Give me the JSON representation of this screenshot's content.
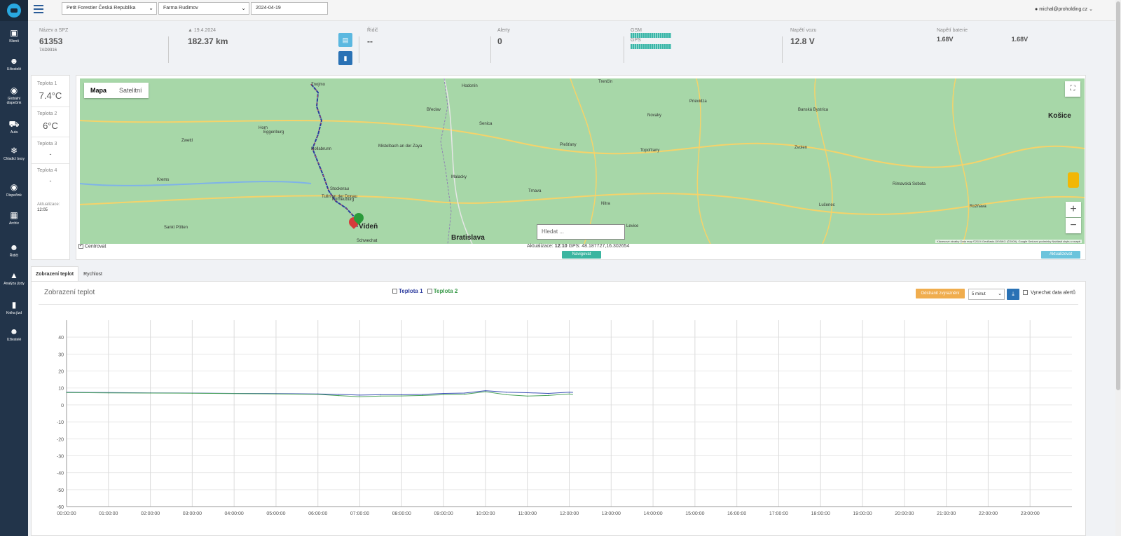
{
  "topbar": {
    "company": "Petit Forestier Česká Republika",
    "farm": "Farma Rudimov",
    "date": "2024-04-19",
    "user": "michal@proholding.cz"
  },
  "sidebar": {
    "items": [
      {
        "label": "Klienti",
        "icon": "briefcase-icon"
      },
      {
        "label": "Uživatelé",
        "icon": "users-icon"
      },
      {
        "label": "Globální dispečink",
        "icon": "compass-icon"
      },
      {
        "label": "Auta",
        "icon": "truck-icon"
      },
      {
        "label": "Chladicí boxy",
        "icon": "snowflake-icon"
      },
      {
        "label": "Dispečink",
        "icon": "car-icon"
      },
      {
        "label": "Archiv",
        "icon": "archive-icon"
      },
      {
        "label": "Řidiči",
        "icon": "driver-icon"
      },
      {
        "label": "Analýza jízdy",
        "icon": "area-chart-icon"
      },
      {
        "label": "Kniha jízd",
        "icon": "book-icon"
      },
      {
        "label": "Uživatelé",
        "icon": "users-icon"
      }
    ]
  },
  "stats": {
    "name_label": "Název a SPZ",
    "name_value": "61353",
    "spz": "7AD9316",
    "date_label": "19.4.2024",
    "distance": "182.37 km",
    "driver_label": "Řidič",
    "driver_value": "--",
    "alerts_label": "Alerty",
    "alerts_value": "0",
    "gsm_label": "GSM",
    "gps_label": "GPS",
    "vehicle_voltage_label": "Napětí vozu",
    "vehicle_voltage_value": "12.8 V",
    "battery_voltage_label": "Napětí baterie",
    "battery_voltage_value1": "1.68V",
    "battery_voltage_value2": "1.68V"
  },
  "temps": {
    "t1_label": "Teplota 1",
    "t1_value": "7.4°C",
    "t2_label": "Teplota 2",
    "t2_value": "6°C",
    "t3_label": "Teplota 3",
    "t3_value": "-",
    "t4_label": "Teplota 4",
    "t4_value": "-",
    "update_label": "Aktualizace:",
    "update_value": "12:05"
  },
  "map": {
    "tab_map": "Mapa",
    "tab_satellite": "Satelitní",
    "search_placeholder": "Hledat ...",
    "attribution": "Klávesové zkratky   Data map ©2024 GeoBasis-DE/BKG (©2009), Google   Smluvní podmínky   Nahlásit chybu v mapě",
    "labels": [
      {
        "t": "Trenčín",
        "big": false
      },
      {
        "t": "Košice",
        "big": true
      },
      {
        "t": "Bratislava",
        "big": true
      },
      {
        "t": "Vídeň",
        "big": true
      },
      {
        "t": "Znojmo",
        "big": false
      },
      {
        "t": "Hollabrunn",
        "big": false
      },
      {
        "t": "Mistelbach an der Zaya",
        "big": false
      },
      {
        "t": "Břeclav",
        "big": false
      },
      {
        "t": "Hodonín",
        "big": false
      },
      {
        "t": "Senica",
        "big": false
      },
      {
        "t": "Malacky",
        "big": false
      },
      {
        "t": "Trnava",
        "big": false
      },
      {
        "t": "Nitra",
        "big": false
      },
      {
        "t": "Piešťany",
        "big": false
      },
      {
        "t": "Banská Bystrica",
        "big": false
      },
      {
        "t": "Zvolen",
        "big": false
      },
      {
        "t": "Lučenec",
        "big": false
      },
      {
        "t": "Rimavská Sobota",
        "big": false
      },
      {
        "t": "Rožňava",
        "big": false
      },
      {
        "t": "Prievidza",
        "big": false
      },
      {
        "t": "Levice",
        "big": false
      },
      {
        "t": "Krems",
        "big": false
      },
      {
        "t": "Tulln an der Donau",
        "big": false
      },
      {
        "t": "Korneuburg",
        "big": false
      },
      {
        "t": "Sankt Pölten",
        "big": false
      },
      {
        "t": "Horn",
        "big": false
      },
      {
        "t": "Zwettl",
        "big": false
      },
      {
        "t": "Eggenburg",
        "big": false
      },
      {
        "t": "Stockerau",
        "big": false
      },
      {
        "t": "Schwechat",
        "big": false
      },
      {
        "t": "Topoľčany",
        "big": false
      },
      {
        "t": "Novaky",
        "big": false
      }
    ]
  },
  "under_map": {
    "centrovat": "Centrovat",
    "aktualizace_label": "Aktualizace:",
    "aktualizace_time": "12:10",
    "gps_label": "GPS:",
    "gps_value": "48.187727,16.302654",
    "navigate": "Navigovat",
    "refresh": "Aktualizovat"
  },
  "tabs": {
    "temps": "Zobrazení teplot",
    "speed": "Rychlost"
  },
  "chart_panel": {
    "title": "Zobrazení teplot",
    "series1_label": "Teplota 1",
    "series2_label": "Teplota 2",
    "reset_zoom": "Odstranit zvýraznění",
    "interval": "5 minut",
    "skip_alerts": "Vynechat data alertů"
  },
  "colors": {
    "series1": "#3a4fb5",
    "series2": "#4aa35a",
    "route": "#2b3a9e"
  },
  "chart_data": {
    "type": "line",
    "x_ticks": [
      "00:00:00",
      "01:00:00",
      "02:00:00",
      "03:00:00",
      "04:00:00",
      "05:00:00",
      "06:00:00",
      "07:00:00",
      "08:00:00",
      "09:00:00",
      "10:00:00",
      "11:00:00",
      "12:00:00",
      "13:00:00",
      "14:00:00",
      "15:00:00",
      "16:00:00",
      "17:00:00",
      "18:00:00",
      "19:00:00",
      "20:00:00",
      "21:00:00",
      "22:00:00",
      "23:00:00"
    ],
    "y_ticks": [
      40,
      30,
      20,
      10,
      0,
      -10,
      -20,
      -30,
      -40,
      -50,
      -60
    ],
    "ylim": [
      -60,
      50
    ],
    "xlim": [
      0,
      24
    ],
    "grid": true,
    "series": [
      {
        "name": "Teplota 1",
        "x": [
          0,
          1,
          2,
          3,
          4,
          5,
          6,
          6.5,
          7,
          7.5,
          8,
          8.5,
          9,
          9.5,
          10,
          10.5,
          11,
          11.5,
          12,
          12.08
        ],
        "y": [
          7.5,
          7.3,
          7.1,
          7.0,
          6.8,
          6.7,
          6.5,
          6.2,
          5.8,
          6.0,
          6.0,
          6.2,
          6.8,
          7.0,
          8.4,
          7.5,
          7.2,
          6.8,
          7.5,
          7.4
        ]
      },
      {
        "name": "Teplota 2",
        "x": [
          0,
          1,
          2,
          3,
          4,
          5,
          6,
          6.5,
          7,
          7.5,
          8,
          8.5,
          9,
          9.5,
          10,
          10.5,
          11,
          11.5,
          12,
          12.08
        ],
        "y": [
          7.3,
          7.1,
          7.0,
          6.9,
          6.7,
          6.5,
          6.2,
          5.5,
          4.8,
          5.2,
          5.3,
          5.6,
          6.0,
          6.3,
          7.8,
          6.0,
          5.2,
          5.6,
          6.5,
          6.2
        ]
      }
    ]
  }
}
